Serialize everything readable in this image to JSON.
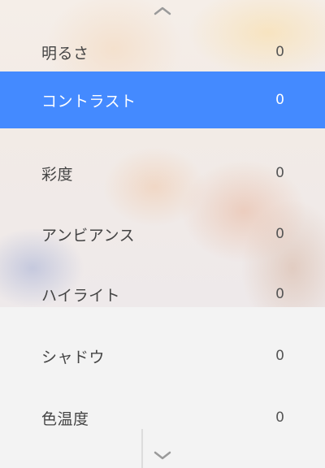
{
  "settings": {
    "items": [
      {
        "label": "明るさ",
        "value": "0"
      },
      {
        "label": "コントラスト",
        "value": "0"
      },
      {
        "label": "彩度",
        "value": "0"
      },
      {
        "label": "アンビアンス",
        "value": "0"
      },
      {
        "label": "ハイライト",
        "value": "0"
      },
      {
        "label": "シャドウ",
        "value": "0"
      },
      {
        "label": "色温度",
        "value": "0"
      }
    ],
    "selected_index": 1
  },
  "icons": {
    "scroll_up": "chevron-up-icon",
    "scroll_down": "chevron-down-icon"
  },
  "colors": {
    "accent": "#448aff",
    "text": "#444444"
  }
}
